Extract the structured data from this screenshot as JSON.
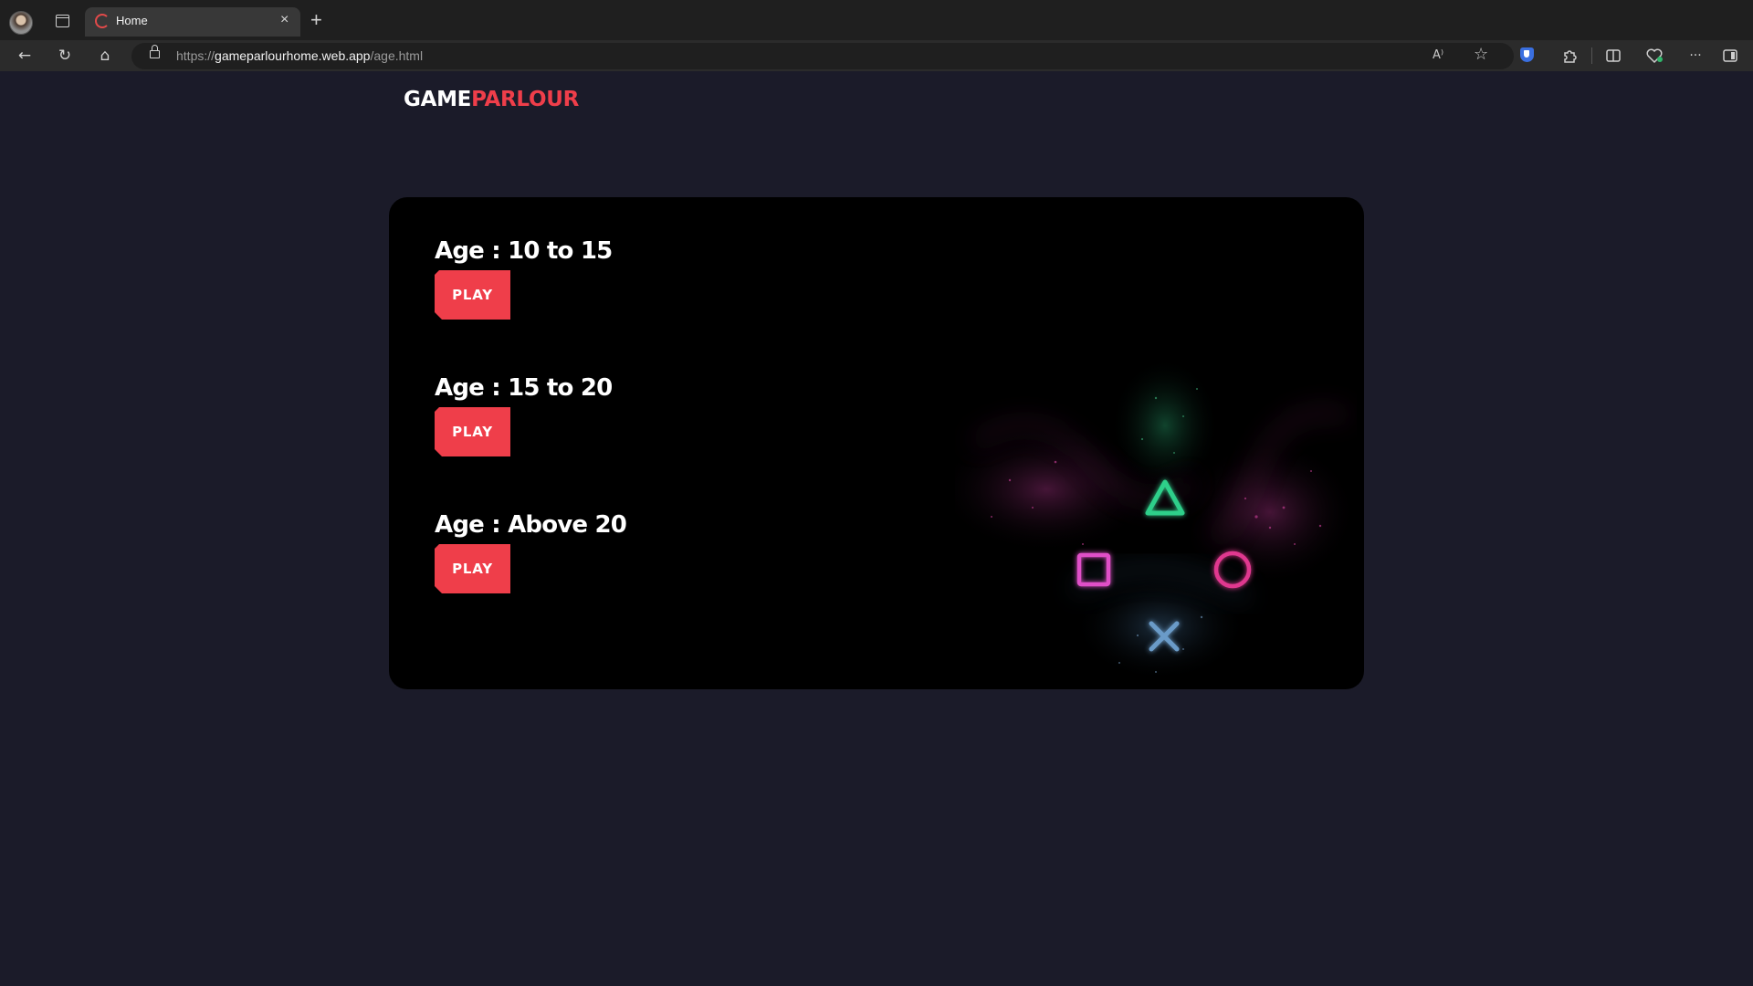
{
  "browser": {
    "tab_title": "Home",
    "tab_close": "×",
    "new_tab": "+",
    "url_scheme": "https://",
    "url_host": "gameparlourhome.web.app",
    "url_path": "/age.html",
    "read_aloud_glyph": "A⁾",
    "favorite_glyph": "☆",
    "more_glyph": "···",
    "back_glyph": "←",
    "refresh_glyph": "↻",
    "home_glyph": "⌂"
  },
  "logo": {
    "part1": "GAME",
    "part2": "PARLOUR"
  },
  "age_groups": [
    {
      "title": "Age : 10 to 15",
      "button": "PLAY"
    },
    {
      "title": "Age : 15 to 20",
      "button": "PLAY"
    },
    {
      "title": "Age : Above 20",
      "button": "PLAY"
    }
  ],
  "colors": {
    "page_bg": "#1b1b29",
    "card_bg": "#000000",
    "accent": "#ef3e4a",
    "triangle": "#2ecf8a",
    "square": "#e04fc8",
    "circle": "#e0378f",
    "cross": "#6a9bc8"
  },
  "art_icons": [
    "triangle-icon",
    "square-icon",
    "circle-icon",
    "cross-icon"
  ]
}
